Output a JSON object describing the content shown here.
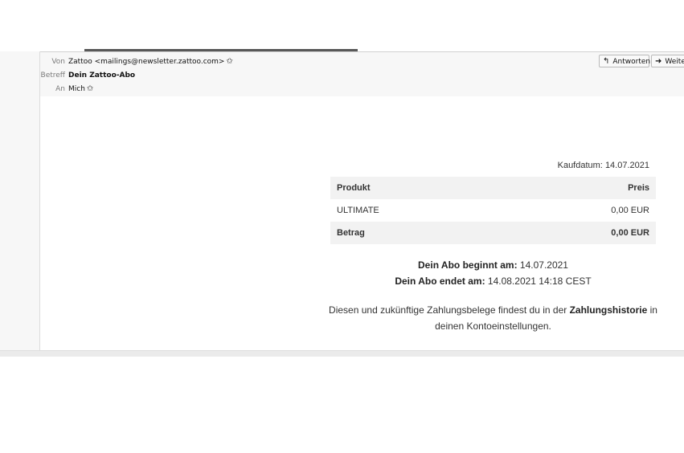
{
  "header": {
    "from_label": "Von",
    "from_value": "Zattoo <mailings@newsletter.zattoo.com>",
    "subject_label": "Betreff",
    "subject_value": "Dein Zattoo-Abo",
    "to_label": "An",
    "to_value": "Mich",
    "reply_button": "Antworten",
    "forward_button": "Weite"
  },
  "receipt": {
    "purchase_date_label": "Kaufdatum:",
    "purchase_date": "14.07.2021",
    "col_product": "Produkt",
    "col_price": "Preis",
    "rows": [
      {
        "product": "ULTIMATE",
        "price": "0,00 EUR"
      }
    ],
    "total_label": "Betrag",
    "total_value": "0,00 EUR"
  },
  "subscription": {
    "start_label": "Dein Abo beginnt am:",
    "start_value": "14.07.2021",
    "end_label": "Dein Abo endet am:",
    "end_value": "14.08.2021 14:18 CEST"
  },
  "note": {
    "text_before": "Diesen und zukünftige Zahlungsbelege findest du in der",
    "link": "Zahlungshistorie",
    "text_after": "in",
    "line2": "deinen Kontoeinstellungen."
  }
}
